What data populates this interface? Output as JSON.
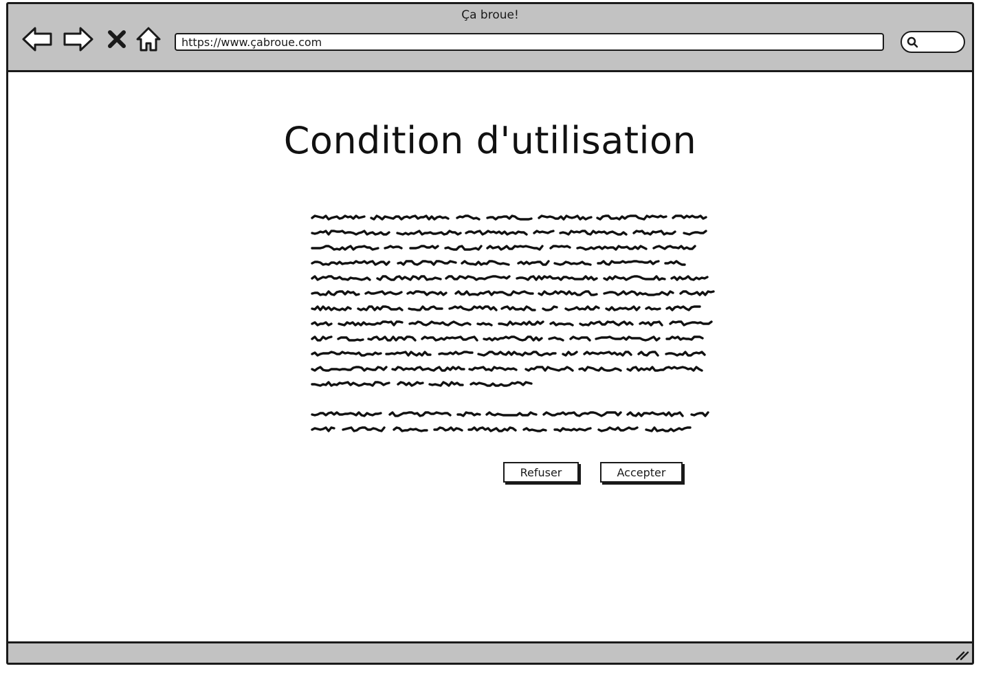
{
  "window": {
    "title": "Ça broue!"
  },
  "toolbar": {
    "back_icon": "arrow-left-icon",
    "forward_icon": "arrow-right-icon",
    "stop_icon": "close-icon",
    "home_icon": "home-icon",
    "url": "https://www.çabroue.com",
    "search_icon": "search-icon"
  },
  "main": {
    "title": "Condition d'utilisation",
    "paragraph1_lines": 12,
    "paragraph2_lines": 2
  },
  "actions": {
    "refuse_label": "Refuser",
    "accept_label": "Accepter"
  },
  "statusbar": {
    "grip_icon": "resize-grip-icon"
  },
  "colors": {
    "chrome": "#c2c2c2",
    "ink": "#1a1a1a",
    "background": "#ffffff"
  }
}
